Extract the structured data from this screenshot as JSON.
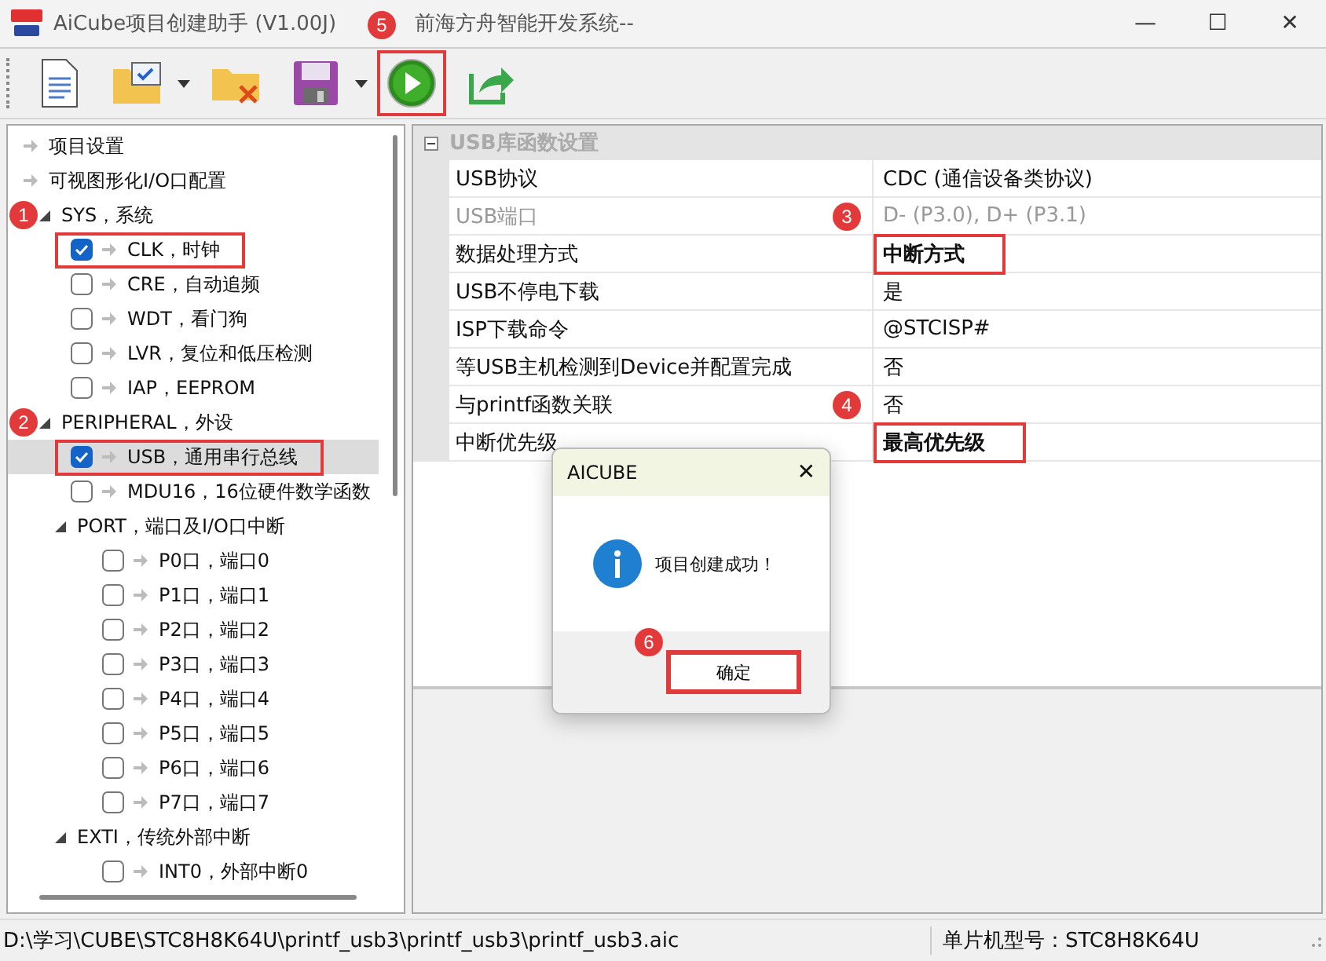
{
  "window": {
    "title": "AiCube项目创建助手 (V1.00J)",
    "subtitle": "前海方舟智能开发系统--",
    "controls": [
      "—",
      "☐",
      "✕"
    ]
  },
  "toolbar": [
    {
      "kind": "new",
      "dropdown": false,
      "highlighted": false
    },
    {
      "kind": "open",
      "dropdown": true,
      "highlighted": false
    },
    {
      "kind": "close",
      "dropdown": false,
      "highlighted": false
    },
    {
      "kind": "save",
      "dropdown": true,
      "highlighted": false
    },
    {
      "kind": "run",
      "dropdown": false,
      "highlighted": true,
      "badge": "5"
    },
    {
      "kind": "export",
      "dropdown": false,
      "highlighted": false
    }
  ],
  "tree": [
    {
      "kind": "link",
      "label": "项目设置"
    },
    {
      "kind": "link",
      "label": "可视图形化I/O口配置"
    },
    {
      "kind": "group",
      "label": "SYS，系统",
      "expanded": true,
      "badge": "1",
      "children": [
        {
          "kind": "check",
          "label": "CLK，时钟",
          "checked": true,
          "selected": false,
          "highlighted": true
        },
        {
          "kind": "check",
          "label": "CRE，自动追频",
          "checked": false,
          "selected": false,
          "highlighted": false
        },
        {
          "kind": "check",
          "label": "WDT，看门狗",
          "checked": false,
          "selected": false,
          "highlighted": false
        },
        {
          "kind": "check",
          "label": "LVR，复位和低压检测",
          "checked": false,
          "selected": false,
          "highlighted": false
        },
        {
          "kind": "check",
          "label": "IAP，EEPROM",
          "checked": false,
          "selected": false,
          "highlighted": false
        }
      ]
    },
    {
      "kind": "group",
      "label": "PERIPHERAL，外设",
      "expanded": true,
      "badge": "2",
      "children": [
        {
          "kind": "check",
          "label": "USB，通用串行总线",
          "checked": true,
          "selected": true,
          "highlighted": true
        },
        {
          "kind": "check",
          "label": "MDU16，16位硬件数学函数",
          "checked": false,
          "selected": false,
          "highlighted": false
        },
        {
          "kind": "group",
          "label": "PORT，端口及I/O口中断",
          "expanded": true,
          "children": [
            {
              "kind": "check",
              "label": "P0口，端口0",
              "checked": false,
              "selected": false,
              "highlighted": false
            },
            {
              "kind": "check",
              "label": "P1口，端口1",
              "checked": false,
              "selected": false,
              "highlighted": false
            },
            {
              "kind": "check",
              "label": "P2口，端口2",
              "checked": false,
              "selected": false,
              "highlighted": false
            },
            {
              "kind": "check",
              "label": "P3口，端口3",
              "checked": false,
              "selected": false,
              "highlighted": false
            },
            {
              "kind": "check",
              "label": "P4口，端口4",
              "checked": false,
              "selected": false,
              "highlighted": false
            },
            {
              "kind": "check",
              "label": "P5口，端口5",
              "checked": false,
              "selected": false,
              "highlighted": false
            },
            {
              "kind": "check",
              "label": "P6口，端口6",
              "checked": false,
              "selected": false,
              "highlighted": false
            },
            {
              "kind": "check",
              "label": "P7口，端口7",
              "checked": false,
              "selected": false,
              "highlighted": false
            }
          ]
        },
        {
          "kind": "group",
          "label": "EXTI，传统外部中断",
          "expanded": true,
          "children": [
            {
              "kind": "check",
              "label": "INT0，外部中断0",
              "checked": false,
              "selected": false,
              "highlighted": false
            }
          ]
        }
      ]
    }
  ],
  "properties": {
    "category": "USB库函数设置",
    "expanded": true,
    "rows": [
      {
        "name": "USB协议",
        "value": "CDC (通信设备类协议)",
        "disabled": false,
        "modified": false,
        "highlighted": false
      },
      {
        "name": "USB端口",
        "value": "D- (P3.0), D+ (P3.1)",
        "disabled": true,
        "modified": false,
        "highlighted": false,
        "badge": "3"
      },
      {
        "name": "数据处理方式",
        "value": "中断方式",
        "disabled": false,
        "modified": true,
        "highlighted": true
      },
      {
        "name": "USB不停电下载",
        "value": "是",
        "disabled": false,
        "modified": false,
        "highlighted": false
      },
      {
        "name": "ISP下载命令",
        "value": "@STCISP#",
        "disabled": false,
        "modified": false,
        "highlighted": false
      },
      {
        "name": "等USB主机检测到Device并配置完成",
        "value": "否",
        "disabled": false,
        "modified": false,
        "highlighted": false
      },
      {
        "name": "与printf函数关联",
        "value": "否",
        "disabled": false,
        "modified": false,
        "highlighted": false,
        "badge": "4"
      },
      {
        "name": "中断优先级",
        "value": "最高优先级",
        "disabled": false,
        "modified": true,
        "highlighted": true
      }
    ]
  },
  "dialog": {
    "title": "AICUBE",
    "close": "✕",
    "message": "项目创建成功！",
    "button": {
      "label": "确定",
      "highlighted": true,
      "badge": "6"
    }
  },
  "status_bar": {
    "path": "D:\\学习\\CUBE\\STC8H8K64U\\printf_usb3\\printf_usb3\\printf_usb3.aic",
    "chip": "单片机型号：STC8H8K64U"
  }
}
